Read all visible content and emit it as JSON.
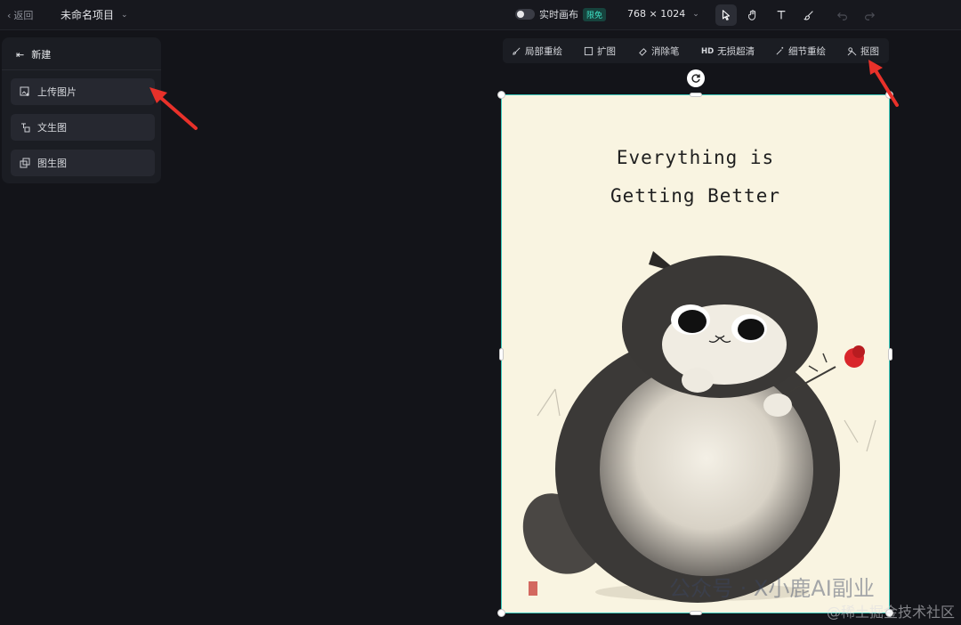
{
  "topbar": {
    "back_label": "返回",
    "project_name": "未命名项目",
    "realtime_label": "实时画布",
    "realtime_badge": "限免",
    "canvas_size": "768 × 1024"
  },
  "panel": {
    "title": "新建",
    "buttons": [
      {
        "label": "上传图片"
      },
      {
        "label": "文生图"
      },
      {
        "label": "图生图"
      }
    ]
  },
  "edit_toolbar": {
    "items": [
      {
        "label": "局部重绘",
        "icon": "brush-icon"
      },
      {
        "label": "扩图",
        "icon": "expand-icon"
      },
      {
        "label": "消除笔",
        "icon": "eraser-icon"
      },
      {
        "hd": "HD",
        "label": "无损超清",
        "icon": "hd-icon"
      },
      {
        "label": "细节重绘",
        "icon": "magic-wand-icon"
      },
      {
        "label": "抠图",
        "icon": "cutout-icon"
      }
    ]
  },
  "canvas": {
    "text_line1": "Everything is",
    "text_line2": "Getting Better",
    "image_subject": "fat black and white cat holding a red rose"
  },
  "watermarks": {
    "line1": "公众号 · X小鹿AI副业",
    "line2": "@稀土掘金技术社区"
  },
  "colors": {
    "accent_teal": "#3cc9bd",
    "arrow_red": "#e8312a",
    "background": "#131419"
  }
}
